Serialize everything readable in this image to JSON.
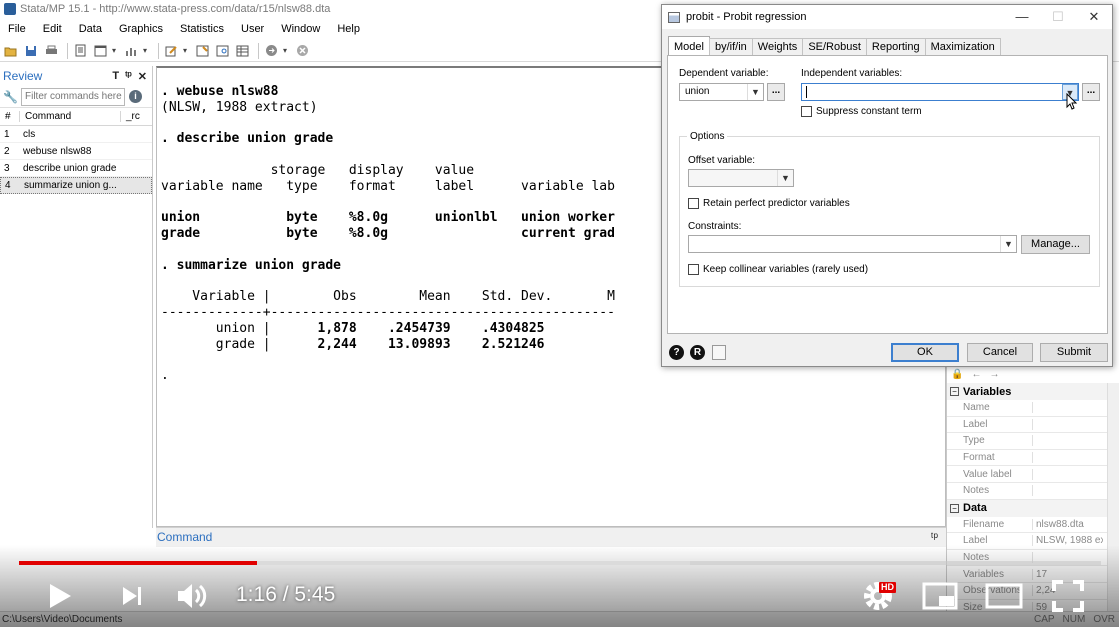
{
  "window": {
    "title": "Stata/MP 15.1 - http://www.stata-press.com/data/r15/nlsw88.dta"
  },
  "menu": [
    "File",
    "Edit",
    "Data",
    "Graphics",
    "Statistics",
    "User",
    "Window",
    "Help"
  ],
  "review": {
    "title": "Review",
    "filter_placeholder": "Filter commands here",
    "col_num": "#",
    "col_command": "Command",
    "col_rc": "_rc",
    "items": [
      {
        "n": "1",
        "cmd": "cls"
      },
      {
        "n": "2",
        "cmd": "webuse nlsw88"
      },
      {
        "n": "3",
        "cmd": "describe union grade"
      },
      {
        "n": "4",
        "cmd": "summarize union g..."
      }
    ]
  },
  "results": {
    "text": ". webuse nlsw88\n(NLSW, 1988 extract)\n\n. describe union grade\n\n              storage   display    value\nvariable name   type    format     label      variable lab\n\nunion           byte    %8.0g      unionlbl   union worker\ngrade           byte    %8.0g                 current grad\n\n. summarize union grade\n\n    Variable |        Obs        Mean    Std. Dev.       M\n-------------+--------------------------------------------\n       union |      1,878    .2454739    .4304825\n       grade |      2,244    13.09893    2.521246\n\n."
  },
  "command_window": {
    "title": "Command"
  },
  "properties": {
    "sections": [
      {
        "title": "Variables",
        "rows": [
          {
            "k": "Name",
            "v": ""
          },
          {
            "k": "Label",
            "v": ""
          },
          {
            "k": "Type",
            "v": ""
          },
          {
            "k": "Format",
            "v": ""
          },
          {
            "k": "Value label",
            "v": ""
          },
          {
            "k": "Notes",
            "v": ""
          }
        ]
      },
      {
        "title": "Data",
        "rows": [
          {
            "k": "Filename",
            "v": "nlsw88.dta"
          },
          {
            "k": "Label",
            "v": "NLSW, 1988 ex"
          },
          {
            "k": "Notes",
            "v": ""
          },
          {
            "k": "Variables",
            "v": "17"
          },
          {
            "k": "Observations",
            "v": "2,24"
          },
          {
            "k": "Size",
            "v": "59"
          }
        ]
      }
    ]
  },
  "statusbar": {
    "path": "C:\\Users\\Video\\Documents",
    "caps": "CAP",
    "num": "NUM",
    "ovr": "OVR"
  },
  "dialog": {
    "title": "probit - Probit regression",
    "tabs": [
      "Model",
      "by/if/in",
      "Weights",
      "SE/Robust",
      "Reporting",
      "Maximization"
    ],
    "dependent_label": "Dependent variable:",
    "dependent_value": "union",
    "independent_label": "Independent variables:",
    "independent_value": "",
    "suppress_label": "Suppress constant term",
    "options_legend": "Options",
    "offset_label": "Offset variable:",
    "retain_label": "Retain perfect predictor variables",
    "constraints_label": "Constraints:",
    "manage_label": "Manage...",
    "keep_label": "Keep collinear variables (rarely used)",
    "ok": "OK",
    "cancel": "Cancel",
    "submit": "Submit",
    "dots": "...",
    "help_glyph": "?",
    "reset_glyph": "R"
  },
  "player": {
    "current_time": "1:16",
    "duration": "5:45",
    "time_display": "1:16 / 5:45",
    "hd_badge": "HD",
    "played_fraction": 0.22,
    "buffered_fraction": 0.62,
    "accent_color": "#e00000"
  }
}
